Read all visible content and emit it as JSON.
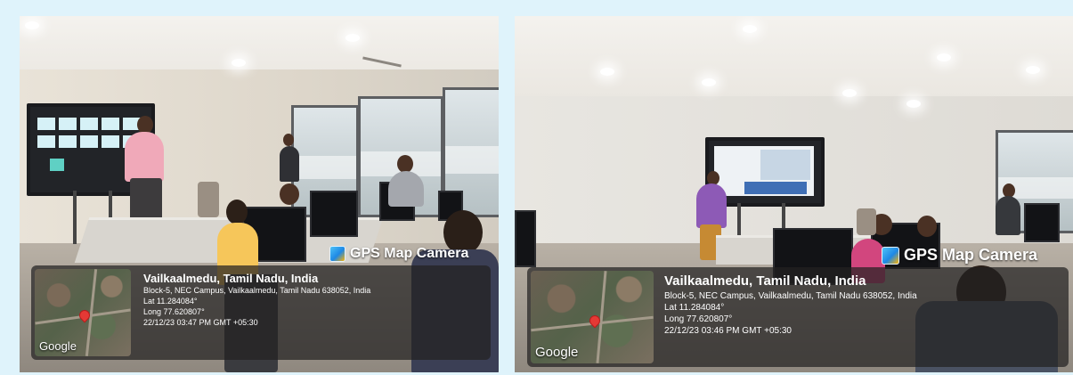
{
  "photos": [
    {
      "brand_label": "GPS Map Camera",
      "map_label": "Google",
      "place": "Vailkaalmedu, Tamil Nadu, India",
      "address": "Block-5, NEC Campus, Vailkaalmedu, Tamil Nadu 638052, India",
      "lat": "Lat 11.284084°",
      "long": "Long 77.620807°",
      "datetime": "22/12/23 03:47 PM GMT +05:30"
    },
    {
      "brand_label": "GPS Map Camera",
      "map_label": "Google",
      "place": "Vailkaalmedu, Tamil Nadu, India",
      "address": "Block-5, NEC Campus, Vailkaalmedu, Tamil Nadu 638052, India",
      "lat": "Lat 11.284084°",
      "long": "Long 77.620807°",
      "datetime": "22/12/23 03:46 PM GMT +05:30"
    }
  ]
}
